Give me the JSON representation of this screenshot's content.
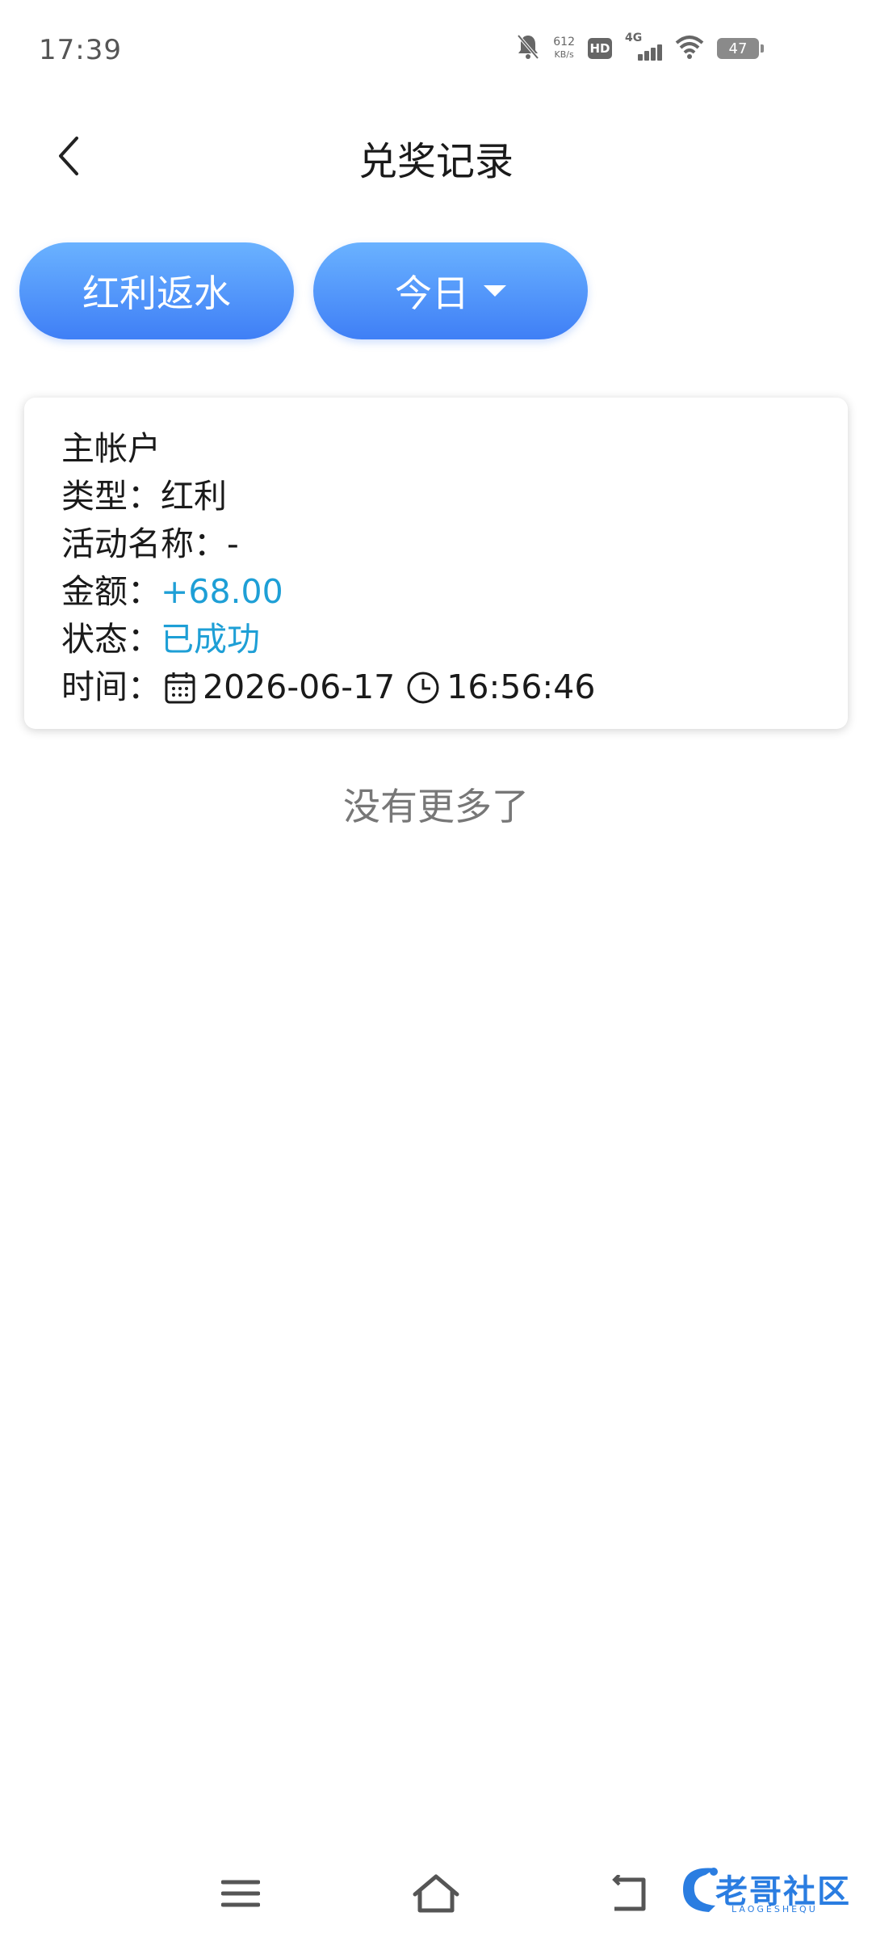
{
  "status_bar": {
    "time": "17:39",
    "net_speed_value": "612",
    "net_speed_unit": "KB/s",
    "hd_label": "HD",
    "network_label": "4G",
    "battery_level": "47",
    "icons": [
      "bell-muted-icon",
      "hd-icon",
      "cell-signal-icon",
      "wifi-icon",
      "battery-icon"
    ]
  },
  "header": {
    "title": "兑奖记录",
    "back_icon": "chevron-left-icon"
  },
  "filters": {
    "category_label": "红利返水",
    "date_label": "今日",
    "date_icon": "caret-down-icon"
  },
  "record": {
    "account": "主帐户",
    "type_label": "类型：",
    "type_value": "红利",
    "activity_label": "活动名称：",
    "activity_value": "-",
    "amount_label": "金额：",
    "amount_value": "+68.00",
    "status_label": "状态：",
    "status_value": "已成功",
    "time_label": "时间：",
    "date_value": "2026-06-17",
    "time_value": "16:56:46",
    "accent_color": "#1e9fd6"
  },
  "footer_text": "没有更多了",
  "nav": {
    "icons": [
      "menu-icon",
      "home-icon",
      "back-icon"
    ]
  },
  "watermark": {
    "text": "老哥社区",
    "subtext": "LAOGESHEQU"
  },
  "colors": {
    "pill_gradient_top": "#6ab2ff",
    "pill_gradient_bottom": "#3f7ff6",
    "accent": "#1e9fd6"
  }
}
